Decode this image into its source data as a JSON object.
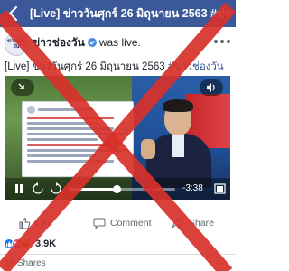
{
  "topbar": {
    "title": "[Live] ข่าววันศุกร์ 26 มิถุนายน 2563 #ข่าวช่...",
    "back_icon": "back-arrow-icon",
    "bg_color": "#3b5998"
  },
  "post": {
    "avatar_text": "ข่าวช่องวัน",
    "page_name": "ข่าวช่องวัน",
    "status": "was live.",
    "caption_prefix": "[Live] ข่าววันศุกร์ 26 มิถุนายน 2563 ",
    "caption_tag": "#ข่าวช่องวัน"
  },
  "video": {
    "time": "-3:38",
    "progress": 0.45
  },
  "actions": {
    "like": "Like",
    "comment": "Comment",
    "share": "Share"
  },
  "reactions": {
    "count": "3.9K",
    "types": [
      "like",
      "love",
      "haha"
    ]
  },
  "shares": "49 Shares",
  "overlay": {
    "x_color": "#d8312b"
  }
}
